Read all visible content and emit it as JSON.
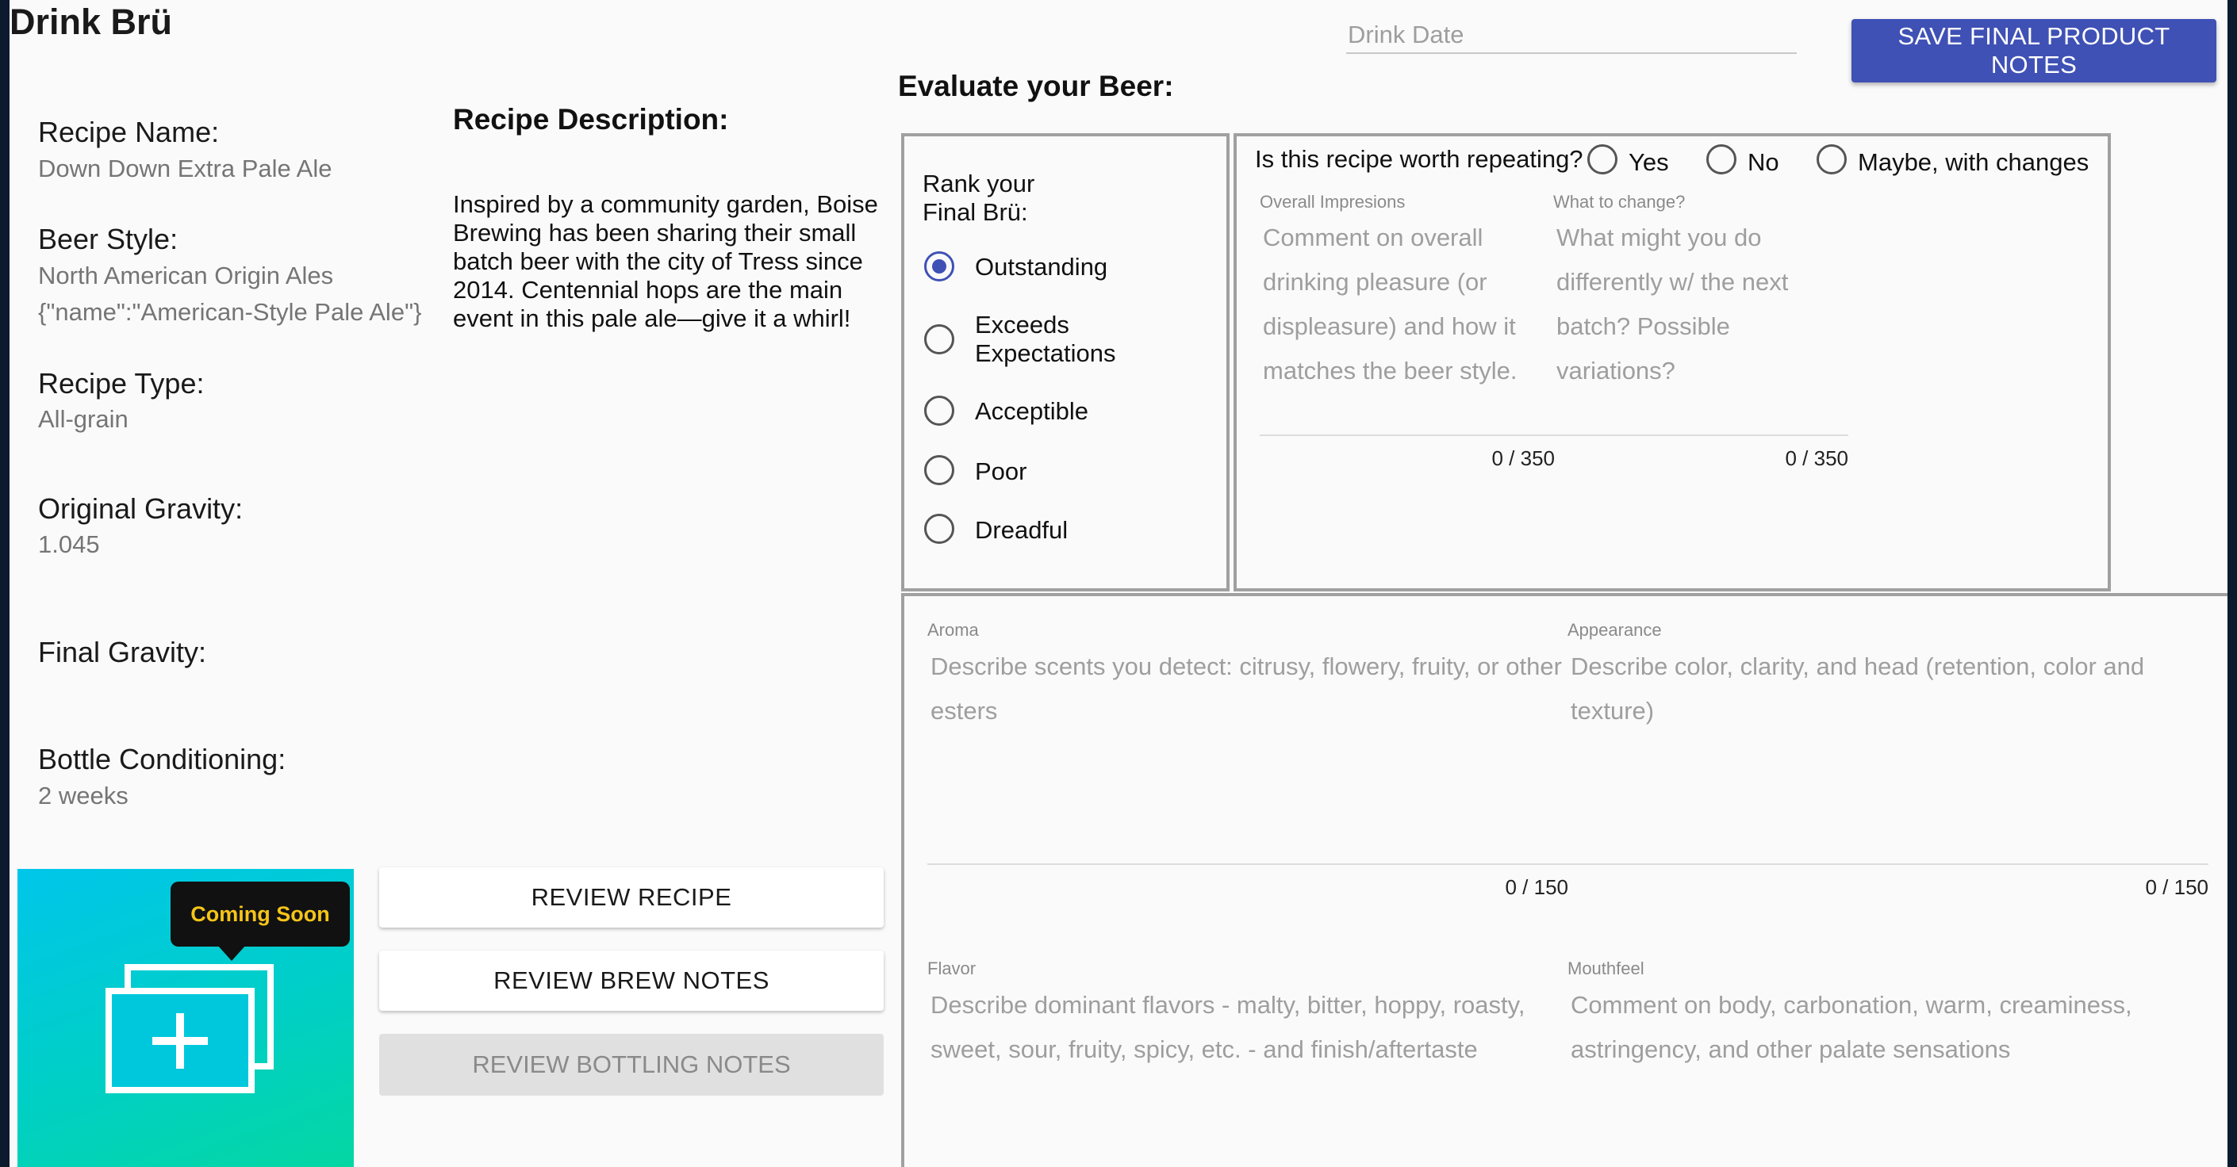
{
  "app": {
    "title": "Drink Brü"
  },
  "recipe": {
    "name_label": "Recipe Name:",
    "name_value": "Down Down Extra Pale Ale",
    "style_label": "Beer Style:",
    "style_value_1": "North American Origin Ales",
    "style_value_2": "{\"name\":\"American-Style Pale Ale\"}",
    "type_label": "Recipe Type:",
    "type_value": "All-grain",
    "og_label": "Original Gravity:",
    "og_value": "1.045",
    "fg_label": "Final Gravity:",
    "fg_value": "",
    "bottle_label": "Bottle Conditioning:",
    "bottle_value": "2 weeks",
    "description_label": "Recipe Description:",
    "description": "Inspired by a community garden, Boise Brewing has been sharing their small batch beer with the city of Tress since 2014. Centennial hops are the main event in this pale ale—give it a whirl!"
  },
  "image": {
    "badge": "Coming Soon",
    "icon": "add-photo-icon"
  },
  "buttons": {
    "review_recipe": "REVIEW RECIPE",
    "review_brew_notes": "REVIEW BREW NOTES",
    "review_bottling_notes": "REVIEW BOTTLING NOTES",
    "save": "SAVE FINAL PRODUCT NOTES"
  },
  "drink_date": {
    "placeholder": "Drink Date",
    "value": ""
  },
  "evaluate": {
    "title": "Evaluate your Beer:",
    "rank_title": "Rank your Final Brü:",
    "rank_options": [
      "Outstanding",
      "Exceeds Expectations",
      "Acceptible",
      "Poor",
      "Dreadful"
    ],
    "rank_selected": "Outstanding",
    "repeat_question": "Is this recipe worth repeating?",
    "repeat_options": [
      "Yes",
      "No",
      "Maybe, with changes"
    ]
  },
  "fields": {
    "overall": {
      "label": "Overall Impresions",
      "placeholder": "Comment on overall drinking pleasure (or displeasure) and how it matches the beer style.",
      "counter": "0 / 350"
    },
    "change": {
      "label": "What to change?",
      "placeholder": "What might you do differently w/ the next batch? Possible variations?",
      "counter": "0 / 350"
    },
    "aroma": {
      "label": "Aroma",
      "placeholder": "Describe scents you detect: citrusy, flowery, fruity, or other esters",
      "counter": "0 / 150"
    },
    "appearance": {
      "label": "Appearance",
      "placeholder": "Describe color, clarity, and head (retention, color and texture)",
      "counter": "0 / 150"
    },
    "flavor": {
      "label": "Flavor",
      "placeholder": "Describe dominant flavors - malty, bitter, hoppy, roasty, sweet, sour, fruity, spicy, etc. - and finish/aftertaste"
    },
    "mouthfeel": {
      "label": "Mouthfeel",
      "placeholder": "Comment on body, carbonation, warm, creaminess, astringency, and other palate sensations"
    }
  },
  "colors": {
    "accent": "#3f51b5",
    "border": "#a0a0a0",
    "muted": "#757575"
  }
}
